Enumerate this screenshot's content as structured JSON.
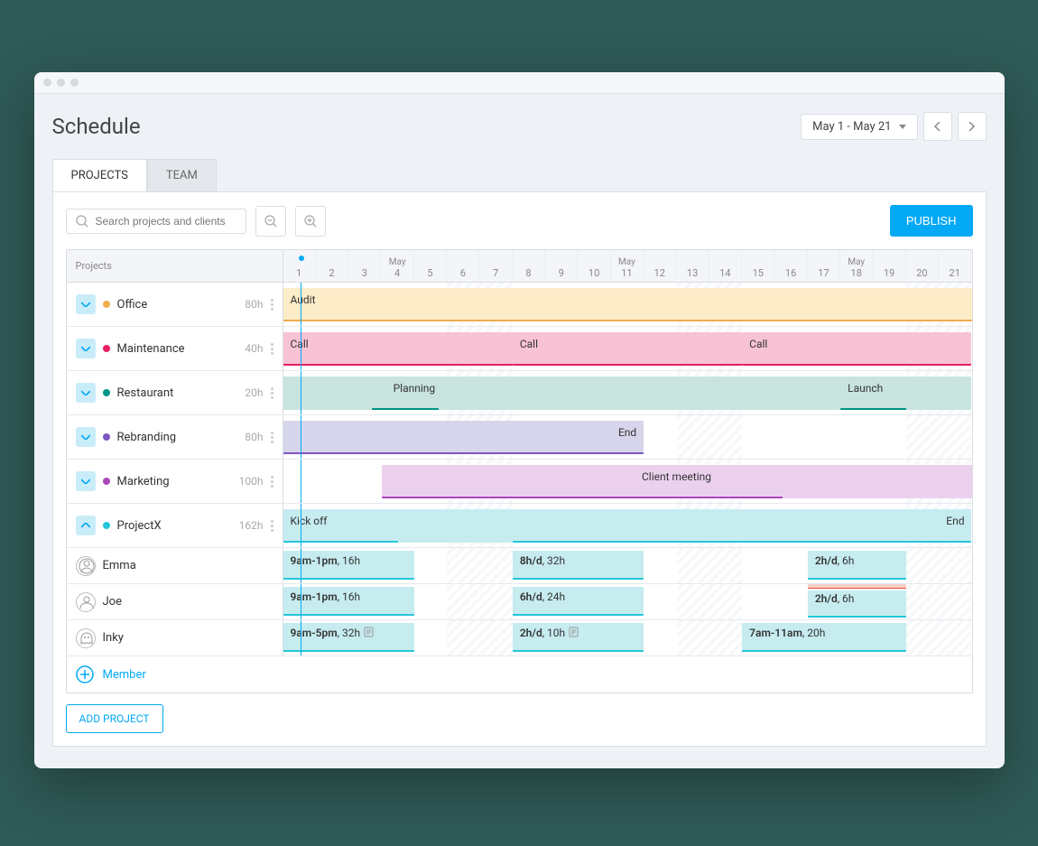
{
  "title": "Schedule",
  "dateRange": "May 1 - May 21",
  "tabs": {
    "projects": "PROJECTS",
    "team": "TEAM"
  },
  "search": {
    "placeholder": "Search projects and clients"
  },
  "publish": "PUBLISH",
  "sideHeader": "Projects",
  "month": "May",
  "days": [
    1,
    2,
    3,
    4,
    5,
    6,
    7,
    8,
    9,
    10,
    11,
    12,
    13,
    14,
    15,
    16,
    17,
    18,
    19,
    20,
    21
  ],
  "weekends": [
    [
      5,
      7
    ],
    [
      12,
      14
    ],
    [
      19,
      21
    ]
  ],
  "projects": {
    "office": {
      "name": "Office",
      "hours": "80h",
      "color": "#f0ad4e",
      "bars": [
        {
          "s": 0,
          "e": 21,
          "label": "Audit",
          "bg": "#fdecc8",
          "u": "#f0ad4e",
          "hatchFrom": 4
        }
      ]
    },
    "maintenance": {
      "name": "Maintenance",
      "hours": "40h",
      "color": "#e91e63",
      "bars": [
        {
          "s": 0,
          "e": 7,
          "label": "Call",
          "bg": "#f8c3d4",
          "u": "#e91e63",
          "hatchFrom": 2
        },
        {
          "s": 7,
          "e": 14,
          "label": "Call",
          "bg": "#f8c3d4",
          "u": "#e91e63",
          "hatchFrom": 2
        },
        {
          "s": 14,
          "e": 21,
          "label": "Call",
          "bg": "#f8c3d4",
          "u": "#e91e63",
          "hatchFrom": 2
        }
      ]
    },
    "restaurant": {
      "name": "Restaurant",
      "hours": "20h",
      "color": "#009688",
      "bars": [
        {
          "s": 0,
          "e": 17,
          "label": "Planning",
          "labelOffset": 16,
          "bg": "#c9e4df",
          "u": "#009688",
          "uStart": 16,
          "uEnd": 28
        },
        {
          "s": 17,
          "e": 21,
          "label": "Launch",
          "bg": "#c9e4df",
          "u": "#009688",
          "uStart": 0,
          "uEnd": 50
        }
      ]
    },
    "rebranding": {
      "name": "Rebranding",
      "hours": "80h",
      "color": "#7e57c2",
      "bars": [
        {
          "s": 0,
          "e": 11,
          "label": "End",
          "labelAlign": "right",
          "bg": "#d6d5eb",
          "u": "#7e57c2"
        }
      ]
    },
    "marketing": {
      "name": "Marketing",
      "hours": "100h",
      "color": "#ab47bc",
      "bars": [
        {
          "s": 3,
          "e": 21,
          "label": "Client meeting",
          "labelAlign": "center",
          "bg": "#ecd1ee",
          "u": "#ab47bc",
          "uStart": 0,
          "uEnd": 68
        }
      ]
    },
    "projectx": {
      "name": "ProjectX",
      "hours": "162h",
      "color": "#26c6da",
      "bars": [
        {
          "s": 0,
          "e": 7,
          "label": "Kick off",
          "bg": "#c6ecf0",
          "u": "#26c6da",
          "uEnd": 50
        },
        {
          "s": 7,
          "e": 14,
          "bg": "#c6ecf0",
          "u": "#26c6da"
        },
        {
          "s": 14,
          "e": 21,
          "label": "End",
          "labelAlign": "right",
          "bg": "#c6ecf0",
          "u": "#26c6da",
          "hatchFrom": 66
        }
      ]
    }
  },
  "members": {
    "emma": {
      "name": "Emma",
      "bars": [
        {
          "s": 0,
          "e": 4,
          "t": "9am-1pm",
          "d": "16h"
        },
        {
          "s": 7,
          "e": 11,
          "t": "8h/d",
          "d": "32h"
        },
        {
          "s": 16,
          "e": 19,
          "t": "2h/d",
          "d": "6h"
        }
      ]
    },
    "joe": {
      "name": "Joe",
      "bars": [
        {
          "s": 0,
          "e": 4,
          "t": "9am-1pm",
          "d": "16h"
        },
        {
          "s": 7,
          "e": 11,
          "t": "6h/d",
          "d": "24h"
        },
        {
          "s": 16,
          "e": 19,
          "t": "2h/d",
          "d": "6h",
          "overbook": true
        }
      ]
    },
    "inky": {
      "name": "Inky",
      "bars": [
        {
          "s": 0,
          "e": 4,
          "t": "9am-5pm",
          "d": "32h",
          "note": true
        },
        {
          "s": 7,
          "e": 11,
          "t": "2h/d",
          "d": "10h",
          "note": true
        },
        {
          "s": 14,
          "e": 19,
          "t": "7am-11am",
          "d": "20h"
        }
      ]
    }
  },
  "addMember": "Member",
  "addProject": "ADD PROJECT"
}
